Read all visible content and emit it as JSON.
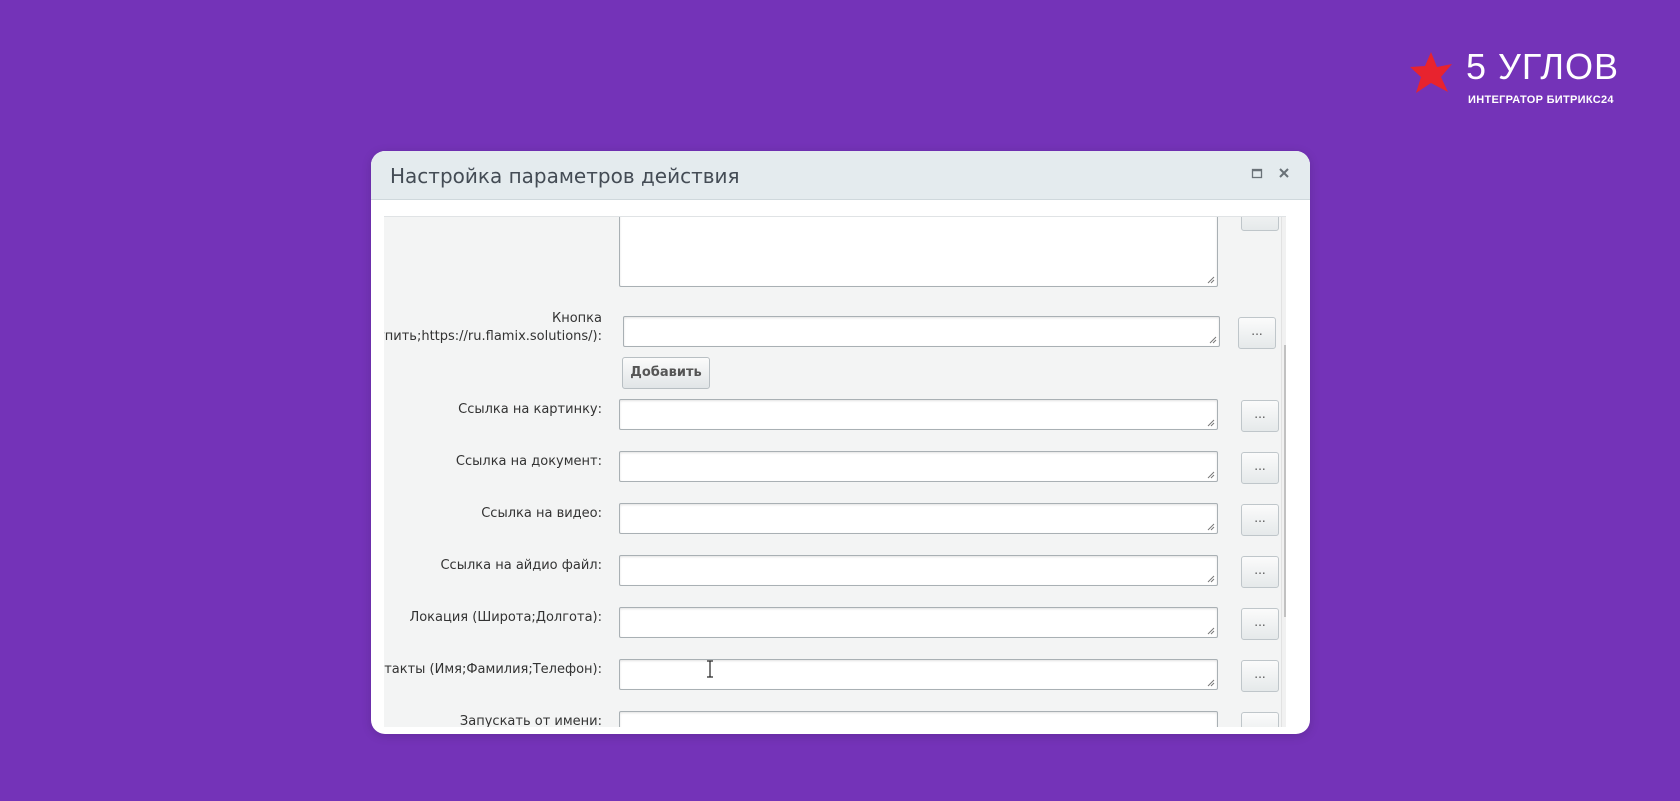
{
  "logo": {
    "title": "5 УГЛОВ",
    "subtitle": "ИНТЕГРАТОР БИТРИКС24",
    "star_color": "#e8232e"
  },
  "dialog": {
    "title": "Настройка параметров действия",
    "maximize_icon": "maximize-icon",
    "close_icon": "close-icon"
  },
  "form": {
    "button_field": {
      "label_line1": "Кнопка",
      "label_line2": "(Купить;https://ru.flamix.solutions/):",
      "value": "",
      "dots": "..."
    },
    "add_label": "Добавить",
    "fields": [
      {
        "label": "Ссылка на картинку:",
        "value": "",
        "dots": "..."
      },
      {
        "label": "Ссылка на документ:",
        "value": "",
        "dots": "..."
      },
      {
        "label": "Ссылка на видео:",
        "value": "",
        "dots": "..."
      },
      {
        "label": "Ссылка на айдио файл:",
        "value": "",
        "dots": "..."
      },
      {
        "label": "Локация (Широта;Долгота):",
        "value": "",
        "dots": "..."
      },
      {
        "label": "Контакты (Имя;Фамилия;Телефон):",
        "value": "",
        "dots": "..."
      },
      {
        "label": "Запускать от имени:",
        "value": "",
        "dots": "..."
      }
    ]
  },
  "colors": {
    "background": "#7433b8",
    "header": "#e4ebee",
    "body": "#f3f4f4"
  }
}
